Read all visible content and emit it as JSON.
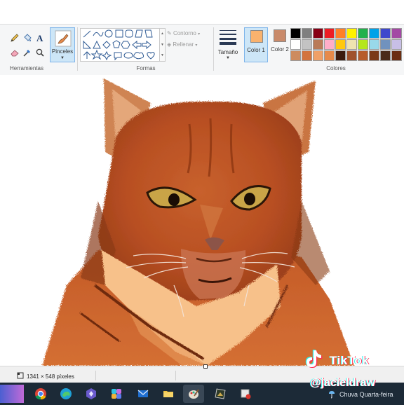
{
  "ribbon": {
    "groups": {
      "tools_label": "Herramientas",
      "shapes_label": "Formas",
      "colors_label": "Colores"
    },
    "brushes_label": "Pinceles",
    "outline_label": "Contorno",
    "fill_label": "Rellenar",
    "size_label": "Tamaño",
    "color1_label": "Color 1",
    "color2_label": "Color 2",
    "color1_value": "#f9b26e",
    "color2_value": "#c98a6a",
    "palette": [
      [
        "#000000",
        "#7f7f7f",
        "#880015",
        "#ed1c24",
        "#ff7f27",
        "#fff200",
        "#22b14c",
        "#00a2e8",
        "#3f48cc",
        "#a349a4"
      ],
      [
        "#ffffff",
        "#c3c3c3",
        "#b97a57",
        "#ffaec9",
        "#ffc90e",
        "#efe4b0",
        "#b5e61d",
        "#99d9ea",
        "#7092be",
        "#c8bfe7"
      ],
      [
        "#cd8b5e",
        "#d3743e",
        "#f0a067",
        "#e68a4a",
        "#3c1b0e",
        "#a0522d",
        "#b75c2a",
        "#7b3a18",
        "#4a2b1a",
        "#6b2e12"
      ]
    ],
    "icons": {
      "pencil": "pencil-icon",
      "fill": "fill-bucket-icon",
      "text": "text-icon",
      "eraser": "eraser-icon",
      "picker": "color-picker-icon",
      "magnifier": "magnifier-icon"
    }
  },
  "canvas": {
    "subject": "painting-cat"
  },
  "status": {
    "dimensions": "1341 × 548 píxeles"
  },
  "taskbar": {
    "weather": "Chuva Quarta-feira"
  },
  "overlay": {
    "tiktok_word": "TikTok",
    "tiktok_user": "@jacieldraw"
  }
}
